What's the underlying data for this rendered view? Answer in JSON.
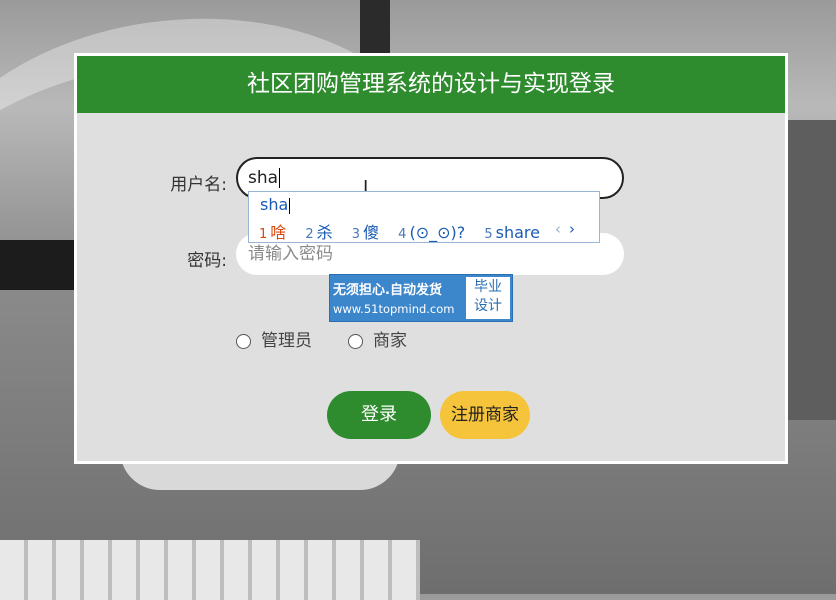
{
  "title": "社区团购管理系统的设计与实现登录",
  "form": {
    "username_label": "用户名:",
    "username_value": "sha",
    "password_label": "密码:",
    "password_placeholder": "请输入密码",
    "roles": [
      "管理员",
      "商家"
    ]
  },
  "ime": {
    "composition": "sha",
    "candidates": [
      {
        "num": "1",
        "text": "啥"
      },
      {
        "num": "2",
        "text": "杀"
      },
      {
        "num": "3",
        "text": "傻"
      },
      {
        "num": "4",
        "text": "(⊙_⊙)?"
      },
      {
        "num": "5",
        "text": "share"
      }
    ],
    "prev": "‹",
    "next": "›"
  },
  "ad": {
    "line1": "无须担心.自动发货",
    "line2": "www.51topmind.com",
    "badge_line1": "毕业",
    "badge_line2": "设计"
  },
  "buttons": {
    "login": "登录",
    "register": "注册商家"
  },
  "colors": {
    "header": "#2e8b2e",
    "login_button": "#2e8b2e",
    "register_button": "#f5c43a",
    "ime_text": "#1a5bb5",
    "ime_first": "#d9480f"
  }
}
